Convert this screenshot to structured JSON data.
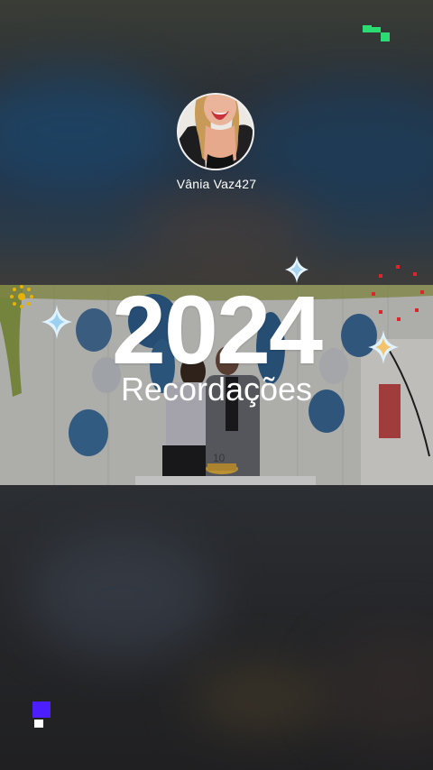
{
  "profile": {
    "username": "Vânia Vaz427"
  },
  "memories": {
    "year": "2024",
    "subtitle": "Recordações"
  },
  "colors": {
    "logo_green": "#2bdc73",
    "logo_purple": "#4b1dff",
    "sparkle": "#dff3ff",
    "fireworks": "#e0242a",
    "balloon": "#3d6f9e"
  },
  "icons": {
    "top_logo": "app-logo-icon",
    "bottom_logo": "watermark-logo-icon"
  }
}
